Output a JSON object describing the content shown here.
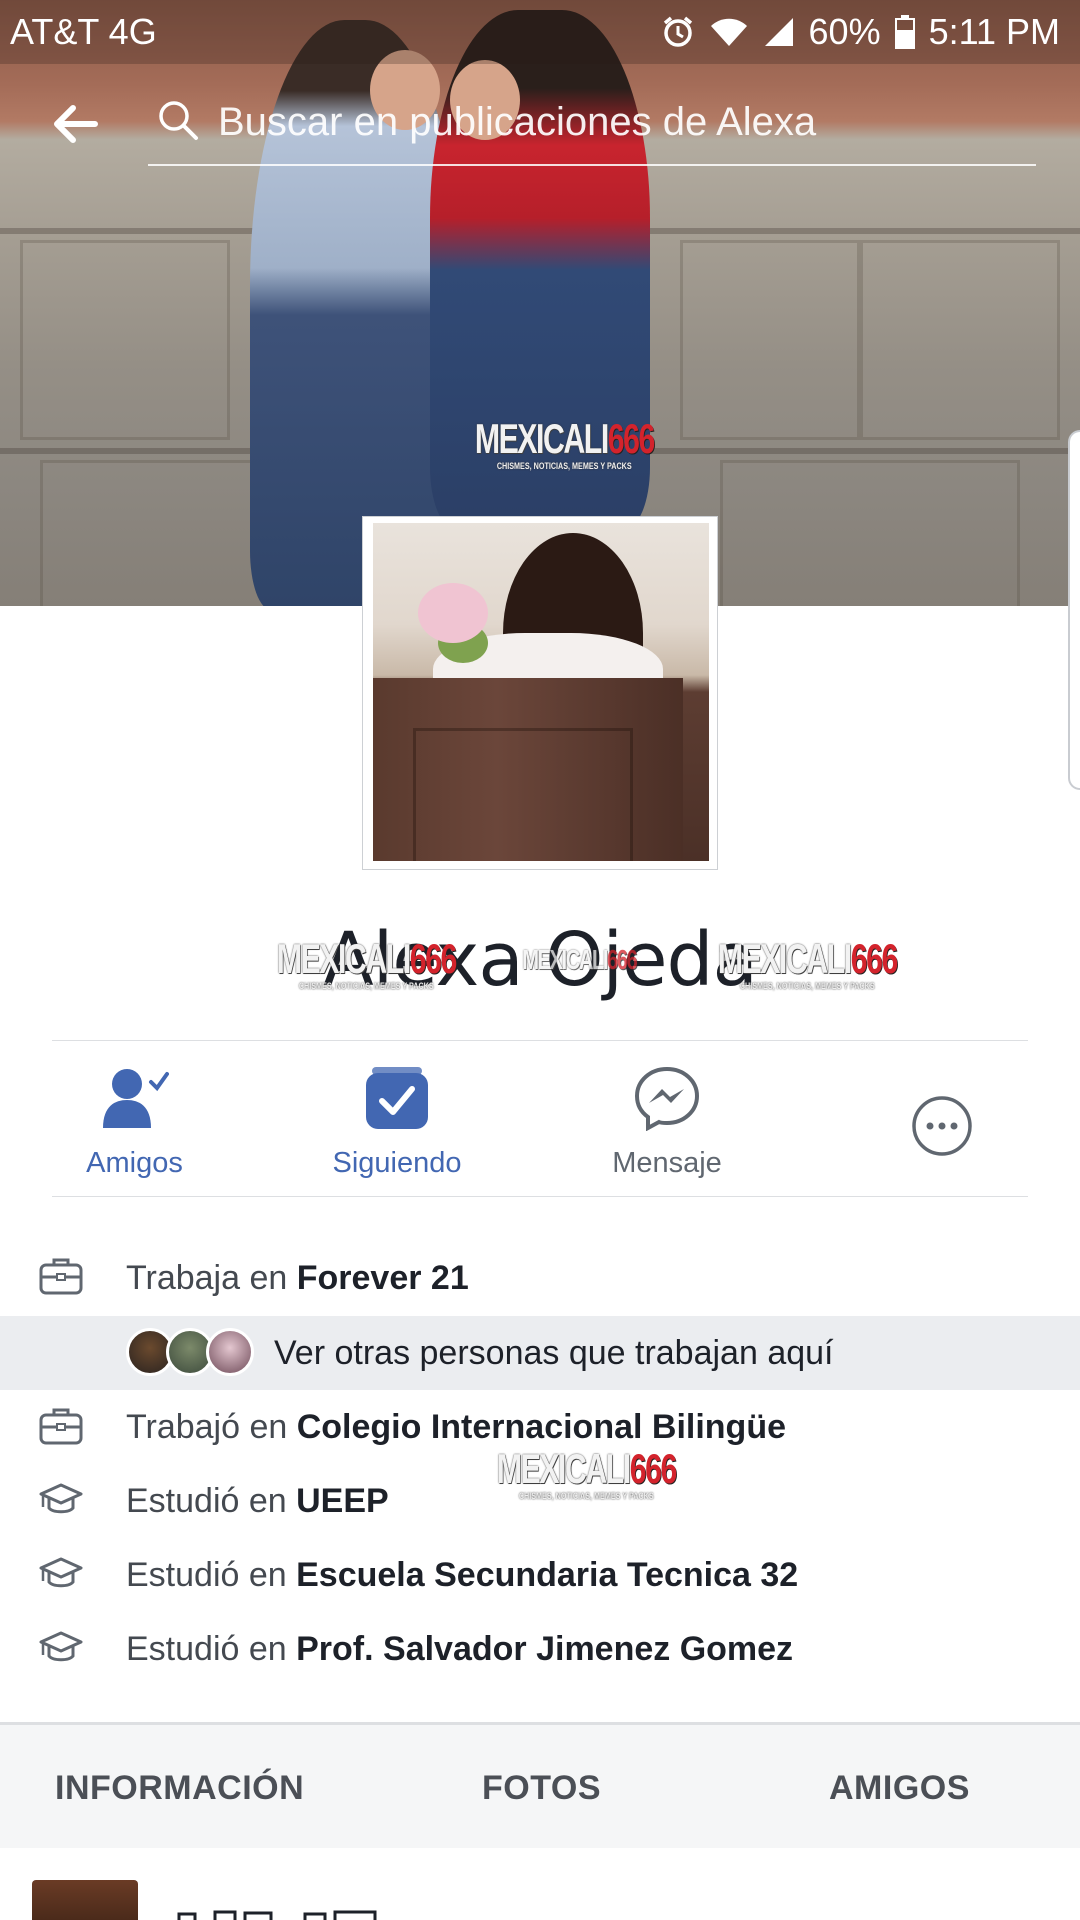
{
  "status_bar": {
    "carrier": "AT&T 4G",
    "battery": "60%",
    "time": "5:11 PM",
    "icons": [
      "alarm-icon",
      "wifi-icon",
      "signal-icon",
      "battery-icon"
    ]
  },
  "header": {
    "back_icon": "back-arrow-icon",
    "search_icon": "search-icon",
    "search_placeholder": "Buscar en publicaciones de Alexa"
  },
  "watermark": {
    "part1": "MEXICALI",
    "part2": "666",
    "tagline": "CHISMES, NOTICIAS, MEMES Y PACKS"
  },
  "profile": {
    "name": "Alexa Ojeda"
  },
  "actions": [
    {
      "label": "Amigos",
      "icon": "friends-check-icon"
    },
    {
      "label": "Siguiendo",
      "icon": "following-check-icon"
    },
    {
      "label": "Mensaje",
      "icon": "messenger-icon"
    },
    {
      "label": "",
      "icon": "more-options-icon"
    }
  ],
  "info": {
    "work_current": {
      "prefix": "Trabaja en ",
      "place": "Forever 21",
      "icon": "briefcase-icon"
    },
    "coworkers_link": "Ver otras personas que trabajan aquí",
    "work_past": {
      "prefix": "Trabajó en ",
      "place": "Colegio Internacional Bilingüe",
      "icon": "briefcase-icon"
    },
    "education": [
      {
        "prefix": "Estudió en ",
        "place": "UEEP",
        "icon": "graduation-cap-icon"
      },
      {
        "prefix": "Estudió en ",
        "place": "Escuela Secundaria Tecnica 32",
        "icon": "graduation-cap-icon"
      },
      {
        "prefix": "Estudió en ",
        "place": "Prof. Salvador Jimenez Gomez",
        "icon": "graduation-cap-icon"
      }
    ]
  },
  "tabs": [
    "INFORMACIÓN",
    "FOTOS",
    "AMIGOS"
  ],
  "colors": {
    "accent": "#4267b2",
    "watermark_red": "#d3232c",
    "tab_bg": "#f5f6f7"
  }
}
